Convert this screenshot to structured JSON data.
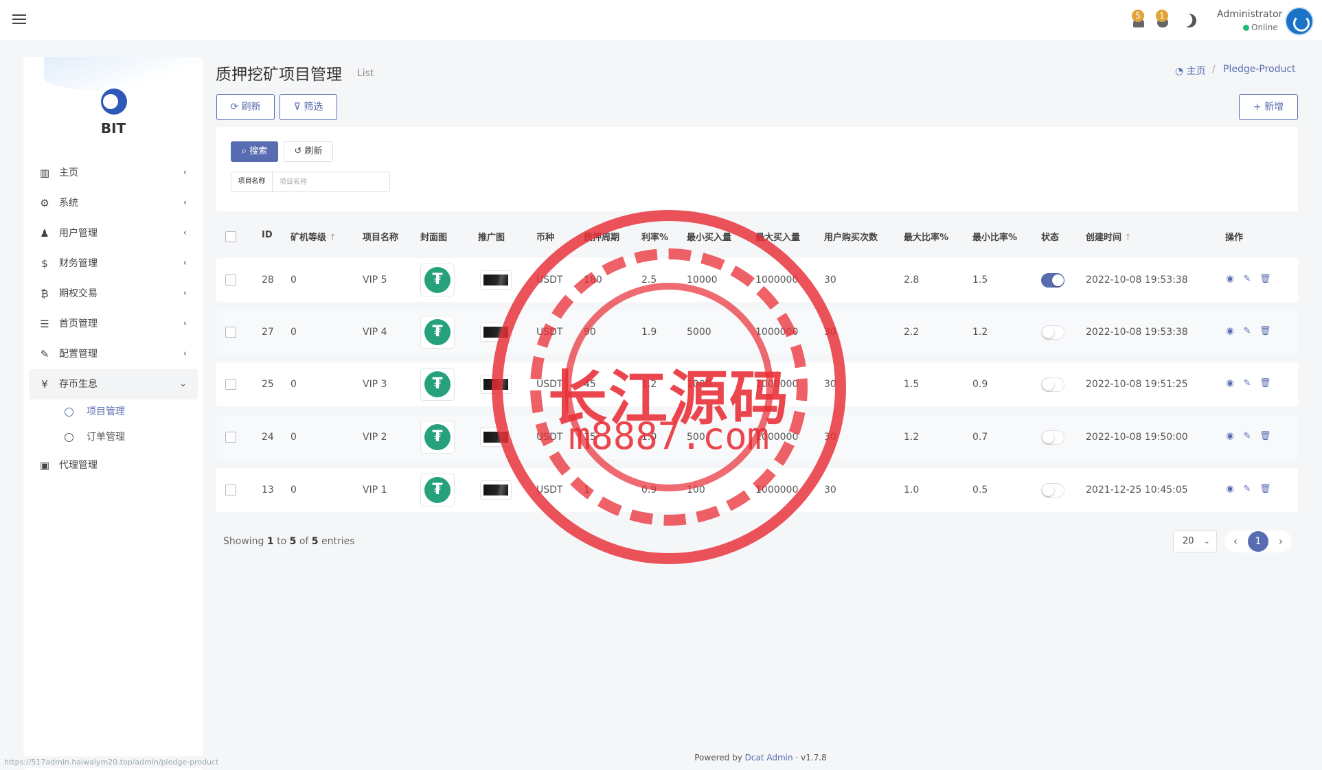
{
  "topbar": {
    "notifications": [
      {
        "count": "5"
      },
      {
        "count": "1"
      }
    ],
    "user": {
      "name": "Administrator",
      "status": "Online"
    }
  },
  "sidebar": {
    "brand": "BIT",
    "items": [
      {
        "label": "主页",
        "icon": "bar-chart-icon"
      },
      {
        "label": "系统",
        "icon": "gear-icon"
      },
      {
        "label": "用户管理",
        "icon": "users-icon"
      },
      {
        "label": "财务管理",
        "icon": "dollar-icon"
      },
      {
        "label": "期权交易",
        "icon": "bitcoin-icon"
      },
      {
        "label": "首页管理",
        "icon": "list-icon"
      },
      {
        "label": "配置管理",
        "icon": "wrench-icon"
      },
      {
        "label": "存币生息",
        "icon": "yen-icon"
      },
      {
        "label": "代理管理",
        "icon": "id-card-icon"
      }
    ],
    "subitems": [
      {
        "label": "项目管理"
      },
      {
        "label": "订单管理"
      }
    ]
  },
  "header": {
    "title": "质押挖矿项目管理",
    "subtitle": "List",
    "breadcrumb_home": "主页",
    "breadcrumb_current": "Pledge-Product"
  },
  "toolbar": {
    "refresh": "刷新",
    "filter": "筛选",
    "add": "新增"
  },
  "filter": {
    "search": "搜索",
    "reset": "刷新",
    "field_label": "项目名称",
    "field_placeholder": "项目名称",
    "field_value": ""
  },
  "table": {
    "columns": [
      "ID",
      "矿机等级",
      "项目名称",
      "封面图",
      "推广图",
      "币种",
      "质押周期",
      "利率%",
      "最小买入量",
      "最大买入量",
      "用户购买次数",
      "最大比率%",
      "最小比率%",
      "状态",
      "创建时间",
      "操作"
    ],
    "rows": [
      {
        "id": "28",
        "level": "0",
        "name": "VIP 5",
        "coin": "USDT",
        "cycle": "180",
        "rate": "2.5",
        "min_buy": "10000",
        "max_buy": "1000000",
        "times": "30",
        "max_ratio": "2.8",
        "min_ratio": "1.5",
        "status": true,
        "created": "2022-10-08 19:53:38"
      },
      {
        "id": "27",
        "level": "0",
        "name": "VIP 4",
        "coin": "USDT",
        "cycle": "90",
        "rate": "1.9",
        "min_buy": "5000",
        "max_buy": "1000000",
        "times": "30",
        "max_ratio": "2.2",
        "min_ratio": "1.2",
        "status": false,
        "created": "2022-10-08 19:53:38"
      },
      {
        "id": "25",
        "level": "0",
        "name": "VIP 3",
        "coin": "USDT",
        "cycle": "45",
        "rate": "1.2",
        "min_buy": "1000",
        "max_buy": "1000000",
        "times": "30",
        "max_ratio": "1.5",
        "min_ratio": "0.9",
        "status": false,
        "created": "2022-10-08 19:51:25"
      },
      {
        "id": "24",
        "level": "0",
        "name": "VIP 2",
        "coin": "USDT",
        "cycle": "15",
        "rate": "1.0",
        "min_buy": "500",
        "max_buy": "1000000",
        "times": "30",
        "max_ratio": "1.2",
        "min_ratio": "0.7",
        "status": false,
        "created": "2022-10-08 19:50:00"
      },
      {
        "id": "13",
        "level": "0",
        "name": "VIP 1",
        "coin": "USDT",
        "cycle": "1",
        "rate": "0.9",
        "min_buy": "100",
        "max_buy": "1000000",
        "times": "30",
        "max_ratio": "1.0",
        "min_ratio": "0.5",
        "status": false,
        "created": "2021-12-25 10:45:05"
      }
    ]
  },
  "pagination": {
    "showing_prefix": "Showing",
    "from": "1",
    "to_word": "to",
    "to": "5",
    "of_word": "of",
    "total": "5",
    "suffix": "entries",
    "per_page": "20",
    "current_page": "1"
  },
  "footer": {
    "powered_by": "Powered by",
    "product": "Dcat Admin",
    "separator": "·",
    "version": "v1.7.8"
  },
  "statusbar": {
    "url": "https://517admin.haiwaiym20.top/admin/pledge-product"
  },
  "watermark": {
    "line1": "长江源码",
    "line2": "m8887.com"
  },
  "colors": {
    "accent": "#586cb1",
    "tether": "#26a17b",
    "badge": "#e0a437",
    "online": "#21b978",
    "stamp": "#e82c34"
  }
}
